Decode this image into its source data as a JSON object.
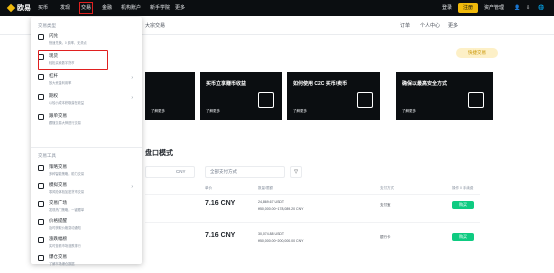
{
  "navbar": {
    "logo_text": "欧易",
    "items": [
      "买币",
      "发现",
      "交易",
      "金融",
      "机构账户",
      "新手学院",
      "更多"
    ],
    "right": {
      "login": "登录",
      "register": "注册",
      "asset_manager": "资产管理"
    }
  },
  "subnav": {
    "item_label": "大宗交易",
    "right_items": [
      "订单",
      "个人中心",
      "更多"
    ]
  },
  "promo_pill": "快捷交易",
  "banners": [
    {
      "title": "",
      "more": "了解更多"
    },
    {
      "title": "买币立享赚币收益",
      "more": "了解更多"
    },
    {
      "title": "如何使用 C2C 买币/卖币",
      "more": "了解更多"
    },
    {
      "title": "确保以最高安全方式",
      "more": "了解更多"
    }
  ],
  "section_title": "盘口模式",
  "filters": {
    "currency": "CNY",
    "payment_placeholder": "全部支付方式"
  },
  "table": {
    "headers": [
      "单价",
      "数量/限额",
      "支付方式",
      "操作 0 手续费"
    ],
    "rows": [
      {
        "price": "7.16 CNY",
        "amount": "24,869.67 USDT",
        "limit": "¥50,000.00~178,089.20 CNY",
        "pay": "支付宝",
        "btn": "购买"
      },
      {
        "price": "7.16 CNY",
        "amount": "30,074.88 USDT",
        "limit": "¥50,000.00~200,000.00 CNY",
        "pay": "银行卡",
        "btn": "购买"
      }
    ]
  },
  "dropdown": {
    "section1": "交易类型",
    "items1": [
      {
        "title": "闪兑",
        "desc": "快速兑换，0 费率，无滑点"
      },
      {
        "title": "现货",
        "desc": "轻松买卖数字货币"
      },
      {
        "title": "杠杆",
        "desc": "放大资金利用率"
      },
      {
        "title": "期权",
        "desc": "以较小成本获取潜在收益"
      },
      {
        "title": "跟单交易",
        "desc": "跟随交易大神进行交易"
      }
    ],
    "section2": "交易工具",
    "items2": [
      {
        "title": "策略交易",
        "desc": "多种智能策略，助力交易"
      },
      {
        "title": "模拟交易",
        "desc": "零风险体验加密货币交易"
      },
      {
        "title": "交易广场",
        "desc": "发现热门策略，一键跟单"
      },
      {
        "title": "价格提醒",
        "desc": "及时获取价格变动通知"
      },
      {
        "title": "涨跌幅榜",
        "desc": "实时查看市场涨跌排行"
      },
      {
        "title": "爆仓交易",
        "desc": "了解市场爆仓数据"
      }
    ]
  }
}
